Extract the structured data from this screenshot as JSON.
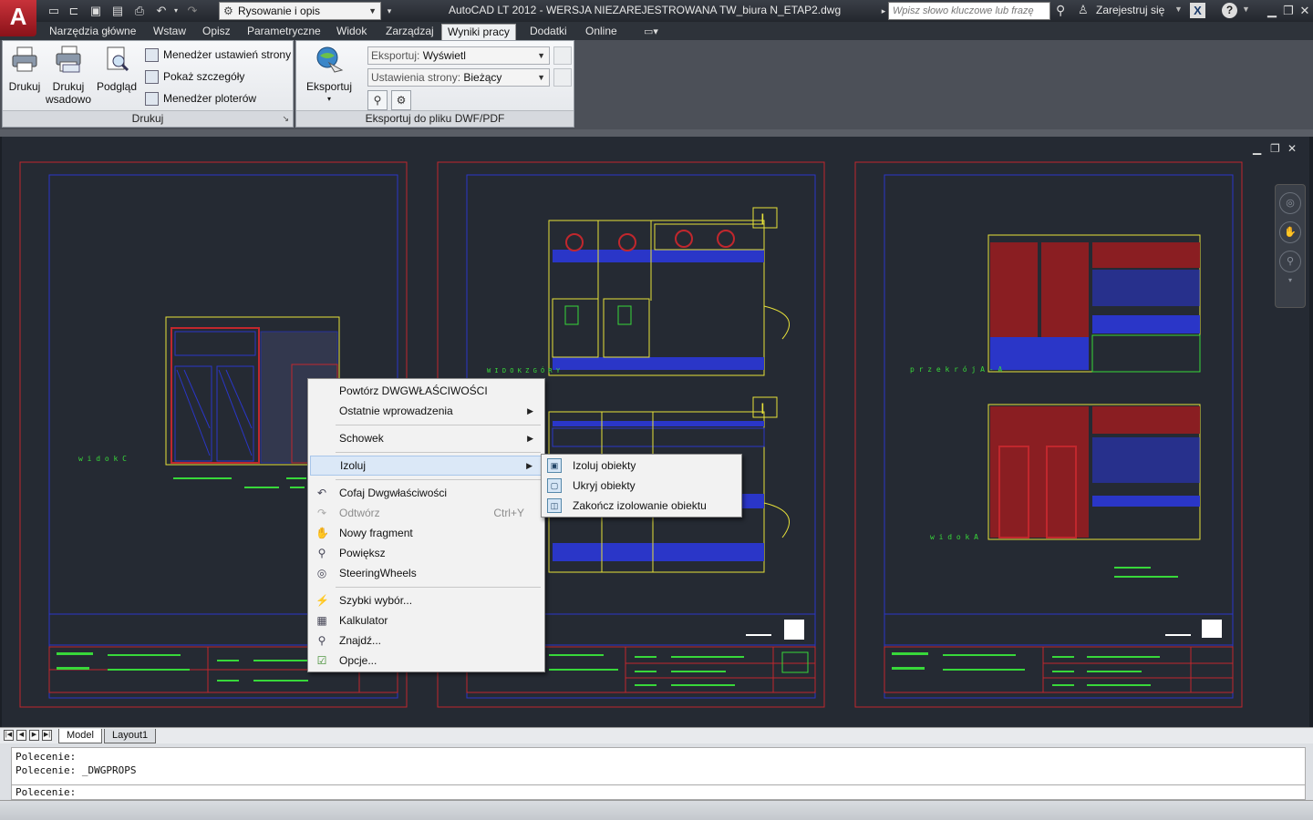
{
  "titlebar": {
    "title": "AutoCAD LT 2012 - WERSJA NIEZAREJESTROWANA    TW_biura N_ETAP2.dwg",
    "workspace": "Rysowanie i opis",
    "search_placeholder": "Wpisz słowo kluczowe lub frazę",
    "signin": "Zarejestruj się",
    "logo_letter": "A"
  },
  "ribbon_tabs": [
    "Narzędzia główne",
    "Wstaw",
    "Opisz",
    "Parametryczne",
    "Widok",
    "Zarządzaj",
    "Wyniki pracy",
    "Dodatki",
    "Online"
  ],
  "ribbon": {
    "print_panel": {
      "title": "Drukuj",
      "print": "Drukuj",
      "batch_line1": "Drukuj",
      "batch_line2": "wsadowo",
      "preview": "Podgląd",
      "page_setup": "Menedżer ustawień strony",
      "details": "Pokaż szczegóły",
      "plotter_manager": "Menedżer ploterów"
    },
    "export_panel": {
      "title": "Eksportuj do pliku DWF/PDF",
      "export_btn": "Eksportuj",
      "export_label": "Eksportuj:",
      "export_value": "Wyświetl",
      "page_label": "Ustawienia strony:",
      "page_value": "Bieżący"
    }
  },
  "layout_tabs": [
    "Model",
    "Layout1"
  ],
  "command": {
    "history": [
      "Polecenie:",
      "Polecenie: _DWGPROPS"
    ],
    "prompt": "Polecenie:"
  },
  "context_menu": {
    "items": [
      {
        "label": "Powtórz DWGWŁAŚCIWOŚCI"
      },
      {
        "label": "Ostatnie wprowadzenia"
      },
      {
        "label": "Schowek"
      },
      {
        "label": "Izoluj"
      },
      {
        "label": "Cofaj Dwgwłaściwości"
      },
      {
        "label": "Odtwórz",
        "shortcut": "Ctrl+Y"
      },
      {
        "label": "Nowy fragment"
      },
      {
        "label": "Powiększ"
      },
      {
        "label": "SteeringWheels"
      },
      {
        "label": "Szybki wybór..."
      },
      {
        "label": "Kalkulator"
      },
      {
        "label": "Znajdź..."
      },
      {
        "label": "Opcje..."
      }
    ]
  },
  "submenu": {
    "items": [
      {
        "label": "Izoluj obiekty"
      },
      {
        "label": "Ukryj obiekty"
      },
      {
        "label": "Zakończ izolowanie obiektu"
      }
    ]
  },
  "drawing": {
    "labels": {
      "widok_c": "w i d o k   C",
      "widok_z_gory": "W I D O K   Z   G Ó R Y",
      "przekroj": "p r z e k r ó j   A - A",
      "widok_a": "w i d o k   A"
    }
  },
  "colors": {
    "red": "#c1272d",
    "blue": "#2a36c8",
    "yellow": "#e8e23a",
    "green": "#38d83a",
    "bg": "#252a33"
  }
}
